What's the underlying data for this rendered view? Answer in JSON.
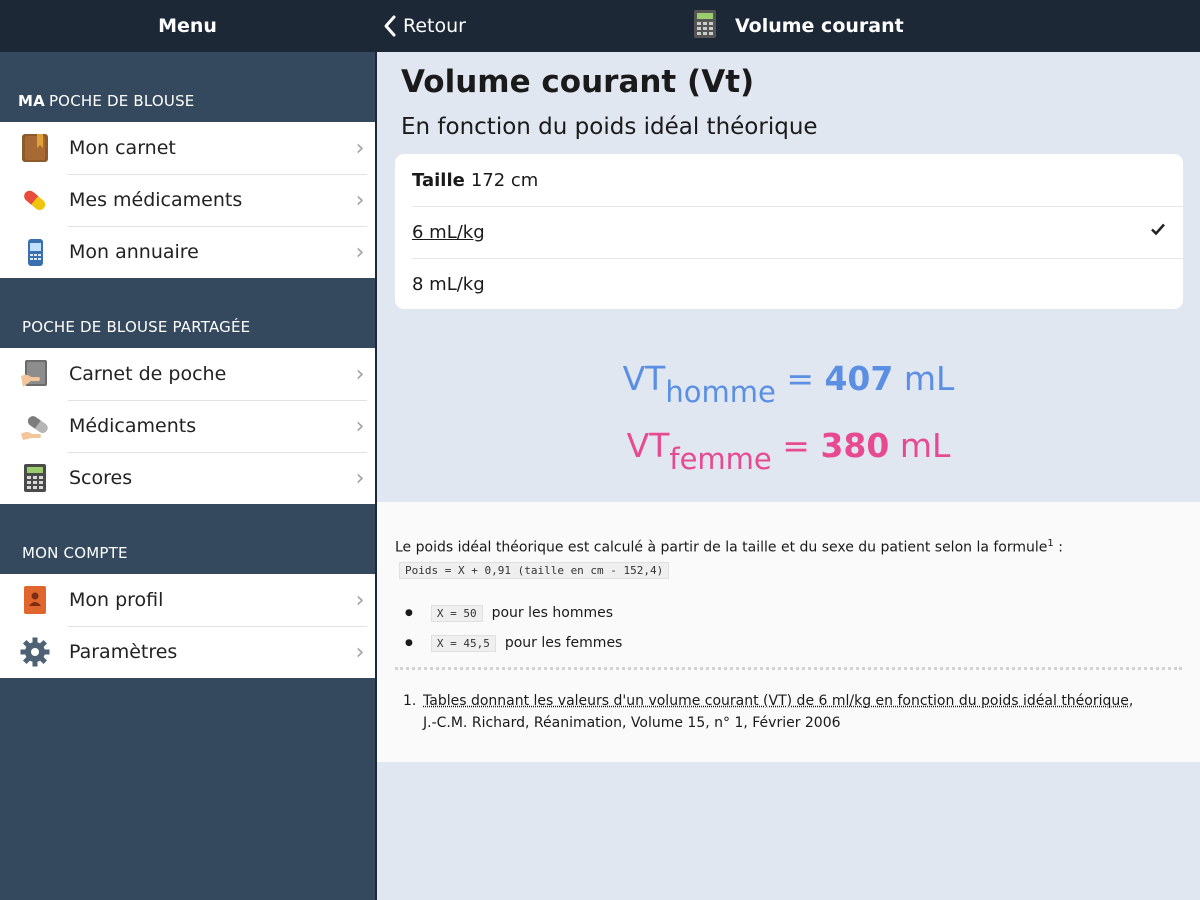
{
  "sidebar": {
    "title": "Menu",
    "sections": [
      {
        "title_bold": "MA",
        "title_rest": "POCHE DE BLOUSE",
        "items": [
          {
            "label": "Mon carnet",
            "icon": "notebook-icon"
          },
          {
            "label": "Mes médicaments",
            "icon": "pill-icon"
          },
          {
            "label": "Mon annuaire",
            "icon": "phone-icon"
          }
        ]
      },
      {
        "title_bold": "",
        "title_rest": "POCHE DE BLOUSE PARTAGÉE",
        "items": [
          {
            "label": "Carnet de poche",
            "icon": "pocket-book-icon"
          },
          {
            "label": "Médicaments",
            "icon": "pills-icon"
          },
          {
            "label": "Scores",
            "icon": "calculator-icon"
          }
        ]
      },
      {
        "title_bold": "",
        "title_rest": "MON COMPTE",
        "items": [
          {
            "label": "Mon profil",
            "icon": "profile-icon"
          },
          {
            "label": "Paramètres",
            "icon": "gear-icon"
          }
        ]
      }
    ]
  },
  "topbar": {
    "back_label": "Retour",
    "title": "Volume courant",
    "title_icon": "calculator-icon"
  },
  "main": {
    "title": "Volume courant (Vt)",
    "subtitle": "En fonction du poids idéal théorique",
    "height_label": "Taille",
    "height_value": "172 cm",
    "options": [
      {
        "label": "6 mL/kg",
        "selected": true
      },
      {
        "label": "8 mL/kg",
        "selected": false
      }
    ],
    "result_male": {
      "prefix": "VT",
      "sub": "homme",
      "eq": "=",
      "value": "407",
      "unit": "mL",
      "color": "#5b8fe3"
    },
    "result_female": {
      "prefix": "VT",
      "sub": "femme",
      "eq": "=",
      "value": "380",
      "unit": "mL",
      "color": "#e84a91"
    }
  },
  "info": {
    "intro": "Le poids idéal théorique est calculé à partir de la taille et du sexe du patient selon la formule",
    "intro_sup": "1",
    "intro_end": " :",
    "formula": "Poids = X + 0,91 (taille en cm - 152,4)",
    "bullets": [
      {
        "code": "X = 50",
        "text": "pour les hommes"
      },
      {
        "code": "X = 45,5",
        "text": "pour les femmes"
      }
    ],
    "footnote_num": "1.",
    "footnote_ref": "Tables donnant les valeurs d'un volume courant (VT) de 6 ml/kg en fonction du poids idéal théorique,",
    "footnote_rest": "J.-C.M. Richard, Réanimation, Volume 15, n° 1, Février 2006"
  }
}
